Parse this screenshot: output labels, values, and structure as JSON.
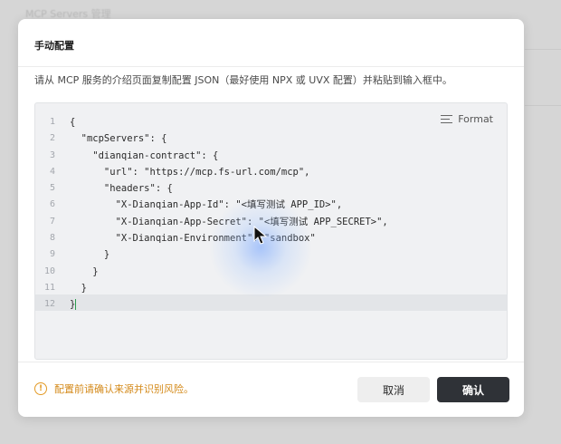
{
  "background": {
    "title": "MCP Servers 管理"
  },
  "modal": {
    "title": "手动配置",
    "description": "请从 MCP 服务的介绍页面复制配置 JSON（最好使用 NPX 或 UVX 配置）并粘贴到输入框中。",
    "editor": {
      "format_label": "Format",
      "format_icon": "format-lines-icon",
      "line_numbers": [
        "1",
        "2",
        "3",
        "4",
        "5",
        "6",
        "7",
        "8",
        "9",
        "10",
        "11",
        "12"
      ],
      "lines": [
        "{",
        "  \"mcpServers\": {",
        "    \"dianqian-contract\": {",
        "      \"url\": \"https://mcp.fs-url.com/mcp\",",
        "      \"headers\": {",
        "        \"X-Dianqian-App-Id\": \"<填写测试 APP_ID>\",",
        "        \"X-Dianqian-App-Secret\": \"<填写测试 APP_SECRET>\",",
        "        \"X-Dianqian-Environment\": \"sandbox\"",
        "      }",
        "    }",
        "  }",
        "}"
      ],
      "active_line": 12
    },
    "warning": {
      "icon": "warning-circle-icon",
      "text": "配置前请确认来源并识别风险。",
      "color": "#d48a1a"
    },
    "buttons": {
      "cancel": "取消",
      "confirm": "确认"
    }
  },
  "colors": {
    "primary_button": "#2f3237",
    "warning": "#e39a25",
    "editor_bg": "#f0f1f3"
  }
}
